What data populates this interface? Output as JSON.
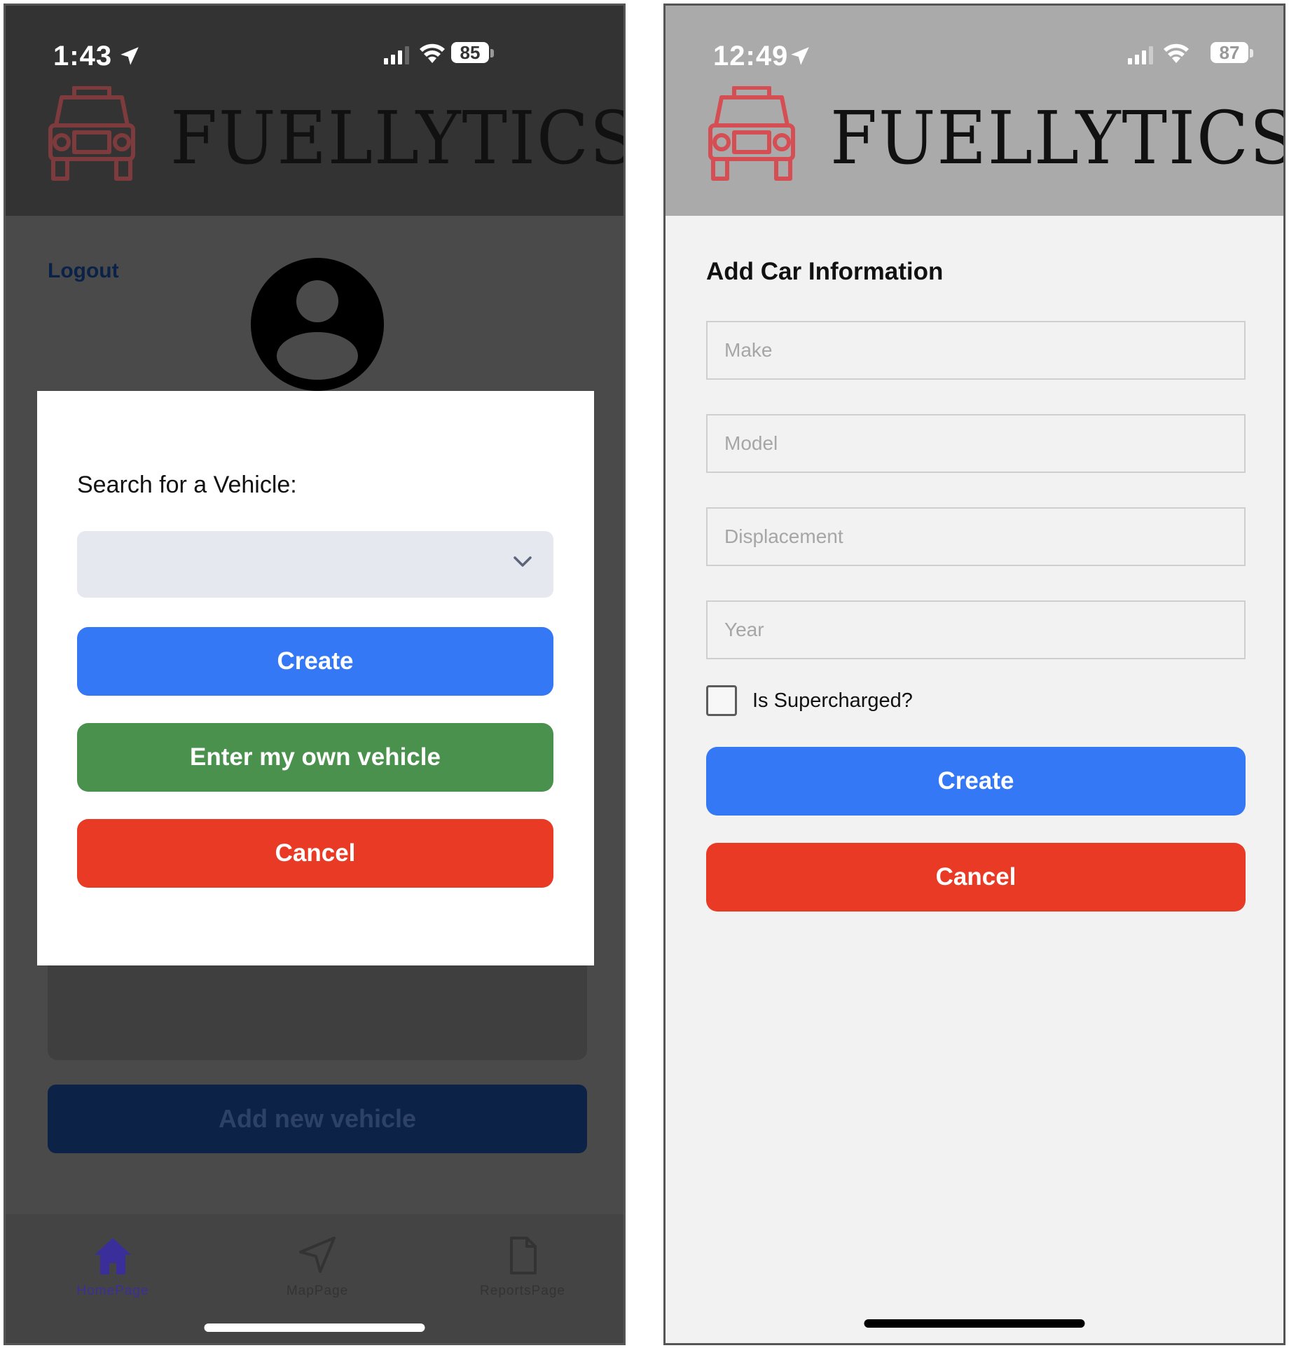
{
  "app": {
    "brand_name": "FUELLYTICS",
    "brand_color": "#d9454a"
  },
  "left_screen": {
    "status": {
      "time": "1:43",
      "battery": "85"
    },
    "logout_label": "Logout",
    "modal": {
      "title": "Search for a Vehicle:",
      "select_value": "",
      "create_label": "Create",
      "enter_own_label": "Enter my own vehicle",
      "cancel_label": "Cancel"
    },
    "background_button_label": "Add new vehicle",
    "tabs": [
      {
        "label": "HomePage",
        "icon": "home-icon",
        "active": true
      },
      {
        "label": "MapPage",
        "icon": "navigation-arrow-icon",
        "active": false
      },
      {
        "label": "ReportsPage",
        "icon": "document-icon",
        "active": false
      }
    ]
  },
  "right_screen": {
    "status": {
      "time": "12:49",
      "battery": "87"
    },
    "title": "Add Car Information",
    "fields": [
      {
        "placeholder": "Make",
        "value": ""
      },
      {
        "placeholder": "Model",
        "value": ""
      },
      {
        "placeholder": "Displacement",
        "value": ""
      },
      {
        "placeholder": "Year",
        "value": ""
      }
    ],
    "supercharged_label": "Is Supercharged?",
    "supercharged_checked": false,
    "create_label": "Create",
    "cancel_label": "Cancel"
  },
  "colors": {
    "primary_blue": "#3478f6",
    "success_green": "#4a914e",
    "danger_red": "#e93a25",
    "navy": "#0c2347"
  }
}
